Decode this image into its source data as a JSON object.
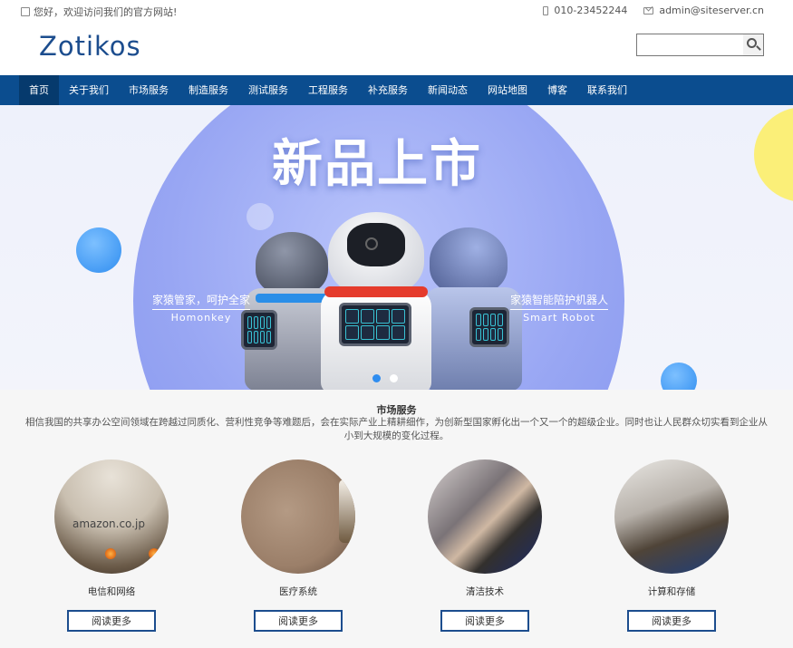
{
  "topbar": {
    "welcome": "您好，欢迎访问我们的官方网站!",
    "phone": "010-23452244",
    "email": "admin@siteserver.cn"
  },
  "header": {
    "logo": "Zotikos",
    "search_placeholder": ""
  },
  "nav": {
    "items": [
      "首页",
      "关于我们",
      "市场服务",
      "制造服务",
      "测试服务",
      "工程服务",
      "补充服务",
      "新闻动态",
      "网站地图",
      "博客",
      "联系我们"
    ],
    "active_index": 0
  },
  "banner": {
    "title": "新品上市",
    "left_caption_cn": "家猿管家，呵护全家",
    "left_caption_en": "Homonkey",
    "right_caption_cn": "家猿智能陪护机器人",
    "right_caption_en": "Smart Robot",
    "slide_count": 2,
    "active_slide": 1
  },
  "section": {
    "title": "市场服务",
    "description": "相信我国的共享办公空间领域在跨越过同质化、营利性竞争等难题后，会在实际产业上精耕细作，为创新型国家孵化出一个又一个的超级企业。同时也让人民群众切实看到企业从小到大规模的变化过程。"
  },
  "cards": [
    {
      "label": "电信和网络",
      "button": "阅读更多",
      "image_text": "amazon.co.jp"
    },
    {
      "label": "医疗系统",
      "button": "阅读更多"
    },
    {
      "label": "清洁技术",
      "button": "阅读更多"
    },
    {
      "label": "计算和存储",
      "button": "阅读更多"
    }
  ],
  "colors": {
    "nav_bg": "#0b4d8f",
    "nav_active_bg": "#063a6d",
    "logo": "#1c4d8e",
    "accent_blue": "#2f8df0"
  }
}
